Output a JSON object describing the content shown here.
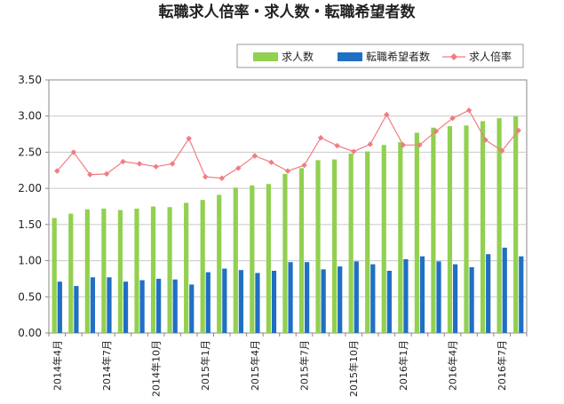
{
  "chart_data": {
    "type": "bar",
    "title": "転職求人倍率・求人数・転職希望者数",
    "xlabel": "",
    "ylabel": "",
    "ylim": [
      0,
      3.5
    ],
    "yticks": [
      "0.00",
      "0.50",
      "1.00",
      "1.50",
      "2.00",
      "2.50",
      "3.00",
      "3.50"
    ],
    "grid": true,
    "legend_position": "top-right",
    "x_tick_labels": [
      "2014年4月",
      "2014年7月",
      "2014年10月",
      "2015年1月",
      "2015年4月",
      "2015年7月",
      "2015年10月",
      "2016年1月",
      "2016年4月",
      "2016年7月"
    ],
    "x_tick_every": 3,
    "series": [
      {
        "name": "求人数",
        "kind": "bar",
        "color": "#92d050",
        "values": [
          1.59,
          1.65,
          1.71,
          1.72,
          1.7,
          1.72,
          1.75,
          1.74,
          1.8,
          1.84,
          1.91,
          2.01,
          2.04,
          2.06,
          2.2,
          2.28,
          2.39,
          2.4,
          2.48,
          2.51,
          2.6,
          2.64,
          2.77,
          2.84,
          2.86,
          2.87,
          2.93,
          2.97,
          3.0
        ]
      },
      {
        "name": "転職希望者数",
        "kind": "bar",
        "color": "#1f6fc5",
        "values": [
          0.71,
          0.65,
          0.77,
          0.77,
          0.71,
          0.73,
          0.75,
          0.74,
          0.67,
          0.84,
          0.89,
          0.87,
          0.83,
          0.86,
          0.98,
          0.98,
          0.88,
          0.92,
          0.99,
          0.95,
          0.86,
          1.02,
          1.06,
          0.99,
          0.95,
          0.91,
          1.09,
          1.18,
          1.06
        ]
      },
      {
        "name": "求人倍率",
        "kind": "line",
        "color": "#f07c82",
        "values": [
          2.24,
          2.5,
          2.19,
          2.2,
          2.37,
          2.34,
          2.3,
          2.34,
          2.69,
          2.16,
          2.14,
          2.28,
          2.45,
          2.36,
          2.24,
          2.32,
          2.7,
          2.59,
          2.51,
          2.61,
          3.02,
          2.6,
          2.6,
          2.79,
          2.97,
          3.08,
          2.67,
          2.52,
          2.8
        ]
      }
    ]
  }
}
